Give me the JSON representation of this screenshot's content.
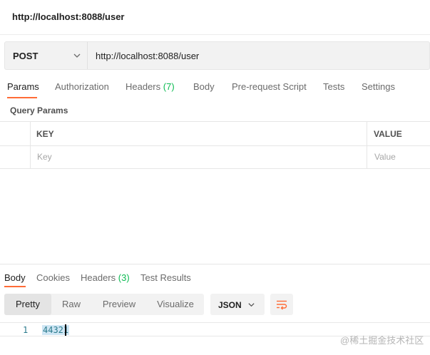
{
  "title": "http://localhost:8088/user",
  "request": {
    "method": "POST",
    "url": "http://localhost:8088/user"
  },
  "request_tabs": {
    "params": "Params",
    "authorization": "Authorization",
    "headers": "Headers",
    "headers_count": "(7)",
    "body": "Body",
    "prerequest": "Pre-request Script",
    "tests": "Tests",
    "settings": "Settings"
  },
  "query_params": {
    "label": "Query Params",
    "key_header": "KEY",
    "value_header": "VALUE",
    "key_placeholder": "Key",
    "value_placeholder": "Value"
  },
  "response_tabs": {
    "body": "Body",
    "cookies": "Cookies",
    "headers": "Headers",
    "headers_count": "(3)",
    "test_results": "Test Results"
  },
  "view_modes": {
    "pretty": "Pretty",
    "raw": "Raw",
    "preview": "Preview",
    "visualize": "Visualize",
    "active": "Pretty"
  },
  "format": "JSON",
  "response_body": {
    "line_number": "1",
    "content": "44321"
  },
  "watermark": "@稀土掘金技术社区",
  "colors": {
    "accent": "#ff6c37",
    "count": "#0cbb52",
    "code": "#2a7a8c",
    "selection": "#cfe6f4"
  },
  "icons": {
    "method_dropdown": "chevron-down-icon",
    "format_dropdown": "chevron-down-icon",
    "wrap": "wrap-lines-icon"
  }
}
